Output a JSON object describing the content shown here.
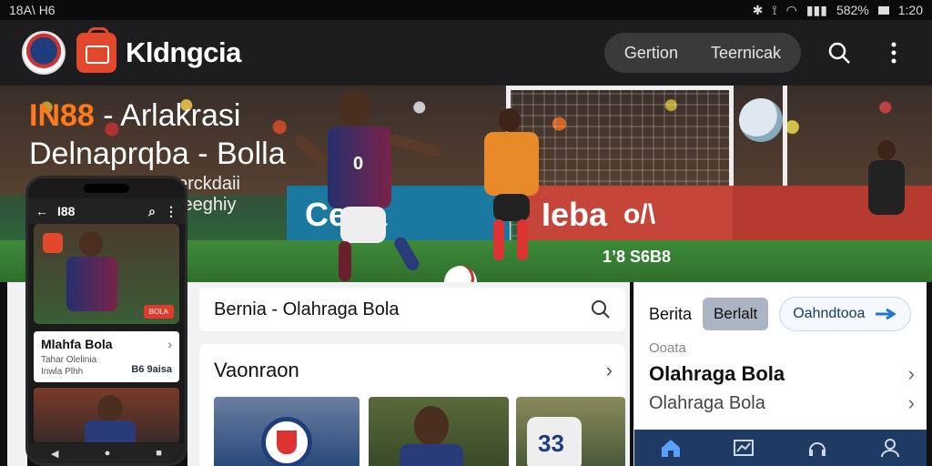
{
  "status_bar": {
    "time_left": "18A\\ H6",
    "battery": "582%",
    "time_right": "1:20"
  },
  "app_bar": {
    "title": "Kldngcia",
    "pill_items": [
      "Gertion",
      "Teernicak"
    ]
  },
  "hero": {
    "headline_accent": "IN88",
    "headline_rest": " - Arlakrasi",
    "subheadline": "Delnaprqba - Bolla",
    "small_line1": "erckdaii",
    "small_line2": "feeghiy",
    "banner_left": "Ceffa",
    "banner_right": "Ieba",
    "banner_right2": "o/\\",
    "score": "1’8 S6B8",
    "jersey_number": "0"
  },
  "phone": {
    "title": "I88",
    "card_title": "Mlahfa Bola",
    "card_sub1": "Tahar Olelinia",
    "card_sub2": "Inwla Plhh",
    "card_number": "B6 9aisa",
    "hero_tag": "BOLA"
  },
  "middle": {
    "search_text": "Bernia - Olahraga Bola",
    "section_title": "Vaonraon"
  },
  "right_panel": {
    "tab_label": "Berita",
    "tab_active": "Berlalt",
    "tab_pill": "Oahndtooa",
    "kicker": "Ooata",
    "row1": "Olahraga Bola",
    "row2": "Olahraga Bola"
  }
}
